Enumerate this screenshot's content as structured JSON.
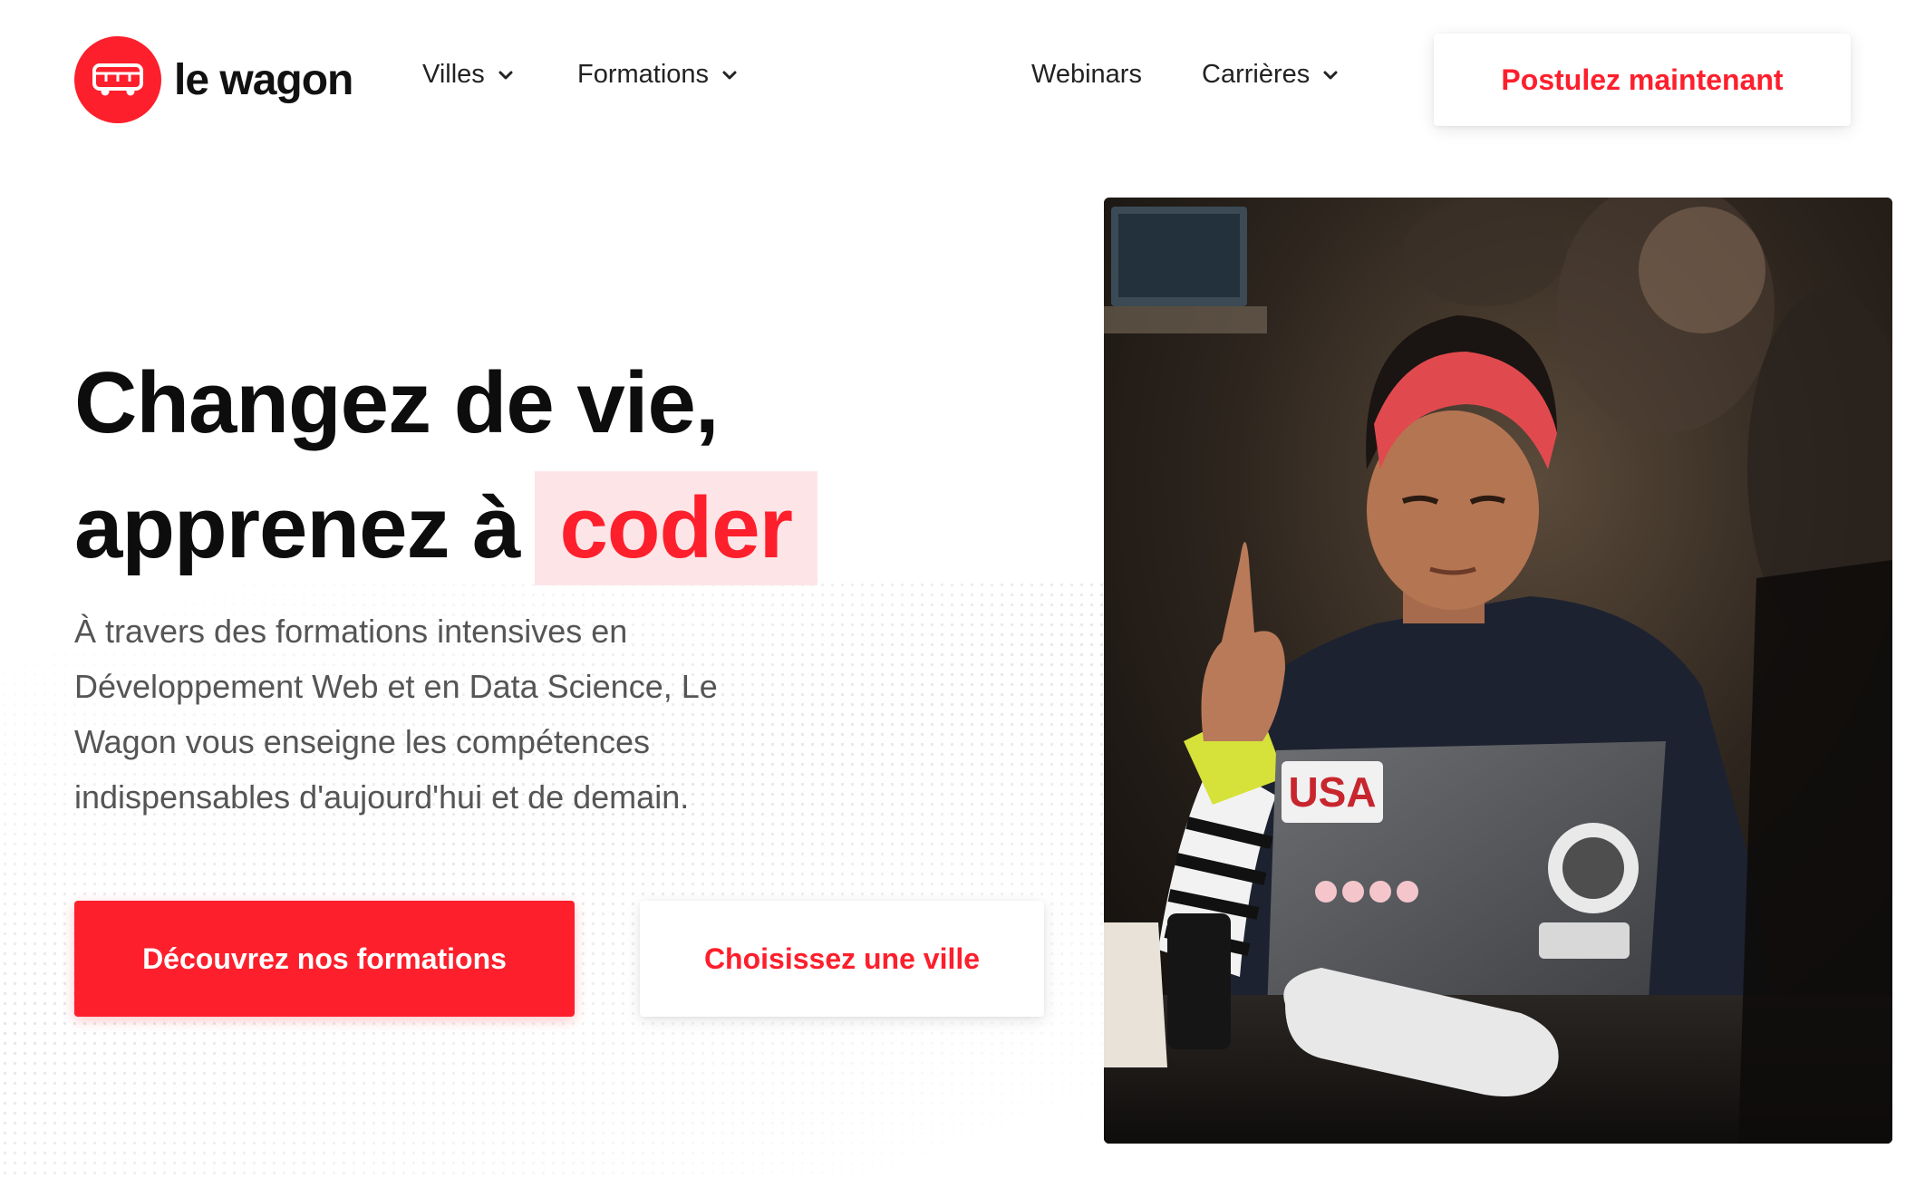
{
  "brand": {
    "name": "le wagon",
    "accent_color": "#fd1f2c",
    "logo_icon": "bus-icon"
  },
  "nav": {
    "items": [
      {
        "label": "Villes",
        "has_dropdown": true
      },
      {
        "label": "Formations",
        "has_dropdown": true
      },
      {
        "label": "Webinars",
        "has_dropdown": false
      },
      {
        "label": "Carrières",
        "has_dropdown": true
      }
    ],
    "cta_label": "Postulez maintenant"
  },
  "hero": {
    "title_line1": "Changez de vie,",
    "title_line2_prefix": "apprenez à",
    "title_highlight": "coder",
    "description": "À travers des formations intensives en Développement Web et en Data Science, Le Wagon vous enseigne les compétences indispensables d'aujourd'hui et de demain.",
    "primary_button": "Découvrez nos formations",
    "secondary_button": "Choisissez une ville",
    "photo_sticker_text": "USA"
  }
}
